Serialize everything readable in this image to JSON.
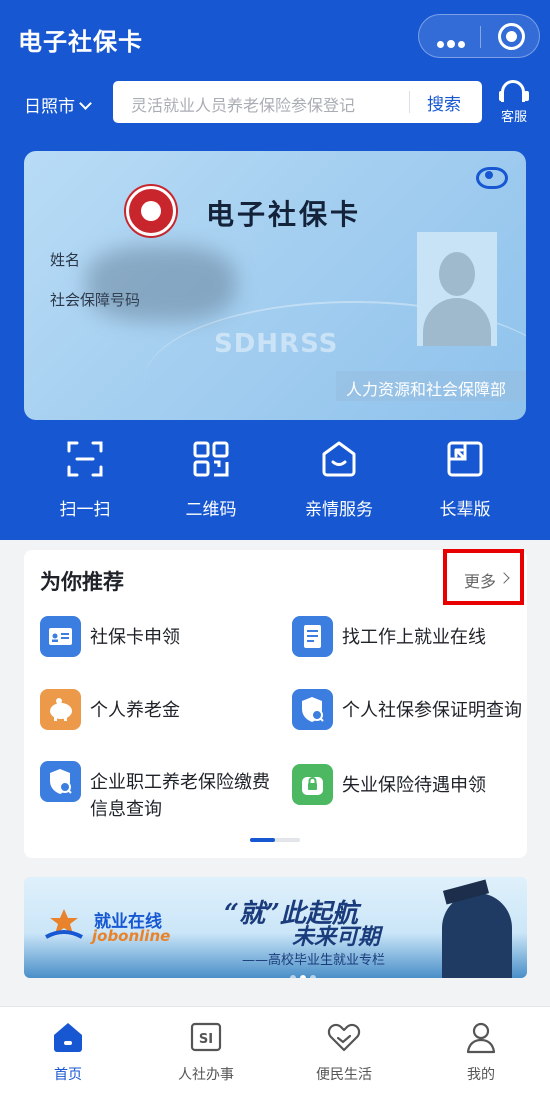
{
  "header": {
    "title": "电子社保卡"
  },
  "location": {
    "city": "日照市"
  },
  "search": {
    "placeholder": "灵活就业人员养老保险参保登记",
    "button": "搜索"
  },
  "service_label": "客服",
  "card": {
    "title": "电子社保卡",
    "name_label": "姓名",
    "ssn_label": "社会保障号码",
    "watermark": "SDHRSS",
    "issuer": "人力资源和社会保障部"
  },
  "quick_actions": [
    {
      "label": "扫一扫",
      "icon": "scan-icon"
    },
    {
      "label": "二维码",
      "icon": "qrcode-icon"
    },
    {
      "label": "亲情服务",
      "icon": "family-service-icon"
    },
    {
      "label": "长辈版",
      "icon": "elder-mode-icon"
    }
  ],
  "recommend": {
    "title": "为你推荐",
    "more": "更多",
    "items": [
      {
        "label": "社保卡申领",
        "icon": "id-card-icon",
        "color": "#3b7ee0"
      },
      {
        "label": "找工作上就业在线",
        "icon": "document-icon",
        "color": "#3b7ee0"
      },
      {
        "label": "个人养老金",
        "icon": "piggy-bank-icon",
        "color": "#ec9a4a"
      },
      {
        "label": "个人社保参保证明查询",
        "icon": "shield-search-icon",
        "color": "#3b7ee0"
      },
      {
        "label": "企业职工养老保险缴费信息查询",
        "icon": "shield-search-icon",
        "color": "#3b7ee0"
      },
      {
        "label": "失业保险待遇申领",
        "icon": "lock-bag-icon",
        "color": "#4cb862"
      }
    ]
  },
  "banner": {
    "logo_cn": "就业在线",
    "logo_en": "jobonline",
    "headline1": "“就”此起航",
    "headline2": "未来可期",
    "subtitle": "——高校毕业生就业专栏"
  },
  "tabbar": [
    {
      "label": "首页",
      "icon": "home-icon",
      "active": true
    },
    {
      "label": "人社办事",
      "icon": "si-icon",
      "active": false
    },
    {
      "label": "便民生活",
      "icon": "heart-hands-icon",
      "active": false
    },
    {
      "label": "我的",
      "icon": "user-icon",
      "active": false
    }
  ],
  "colors": {
    "primary": "#1758d2",
    "highlight": "#e80000"
  }
}
